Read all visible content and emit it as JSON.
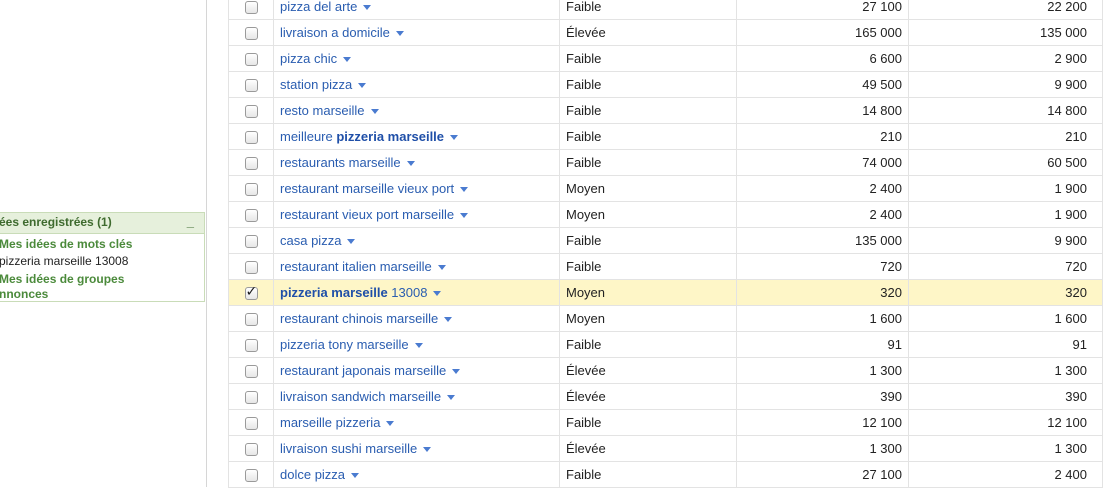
{
  "sidebar": {
    "saved_title": "ées enregistrées (1)",
    "minimize": "_",
    "keyword_ideas_link": "Mes idées de mots clés",
    "saved_keyword": "pizzeria marseille 13008",
    "ad_group_line1": "Mes idées de groupes",
    "ad_group_line2": "nnonces"
  },
  "rows": [
    {
      "pre": "pizza del arte",
      "bold": "",
      "post": "",
      "comp": "Faible",
      "global": "27 100",
      "local": "22 200",
      "checked": false
    },
    {
      "pre": "livraison a domicile",
      "bold": "",
      "post": "",
      "comp": "Élevée",
      "global": "165 000",
      "local": "135 000",
      "checked": false
    },
    {
      "pre": "pizza chic",
      "bold": "",
      "post": "",
      "comp": "Faible",
      "global": "6 600",
      "local": "2 900",
      "checked": false
    },
    {
      "pre": "station pizza",
      "bold": "",
      "post": "",
      "comp": "Faible",
      "global": "49 500",
      "local": "9 900",
      "checked": false
    },
    {
      "pre": "resto marseille",
      "bold": "",
      "post": "",
      "comp": "Faible",
      "global": "14 800",
      "local": "14 800",
      "checked": false
    },
    {
      "pre": "meilleure ",
      "bold": "pizzeria marseille",
      "post": "",
      "comp": "Faible",
      "global": "210",
      "local": "210",
      "checked": false
    },
    {
      "pre": "restaurants marseille",
      "bold": "",
      "post": "",
      "comp": "Faible",
      "global": "74 000",
      "local": "60 500",
      "checked": false
    },
    {
      "pre": "restaurant marseille vieux port",
      "bold": "",
      "post": "",
      "comp": "Moyen",
      "global": "2 400",
      "local": "1 900",
      "checked": false
    },
    {
      "pre": "restaurant vieux port marseille",
      "bold": "",
      "post": "",
      "comp": "Moyen",
      "global": "2 400",
      "local": "1 900",
      "checked": false
    },
    {
      "pre": "casa pizza",
      "bold": "",
      "post": "",
      "comp": "Faible",
      "global": "135 000",
      "local": "9 900",
      "checked": false
    },
    {
      "pre": "restaurant italien marseille",
      "bold": "",
      "post": "",
      "comp": "Faible",
      "global": "720",
      "local": "720",
      "checked": false
    },
    {
      "pre": "",
      "bold": "pizzeria marseille",
      "post": " 13008",
      "comp": "Moyen",
      "global": "320",
      "local": "320",
      "checked": true
    },
    {
      "pre": "restaurant chinois marseille",
      "bold": "",
      "post": "",
      "comp": "Moyen",
      "global": "1 600",
      "local": "1 600",
      "checked": false
    },
    {
      "pre": "pizzeria tony marseille",
      "bold": "",
      "post": "",
      "comp": "Faible",
      "global": "91",
      "local": "91",
      "checked": false
    },
    {
      "pre": "restaurant japonais marseille",
      "bold": "",
      "post": "",
      "comp": "Élevée",
      "global": "1 300",
      "local": "1 300",
      "checked": false
    },
    {
      "pre": "livraison sandwich marseille",
      "bold": "",
      "post": "",
      "comp": "Élevée",
      "global": "390",
      "local": "390",
      "checked": false
    },
    {
      "pre": "marseille pizzeria",
      "bold": "",
      "post": "",
      "comp": "Faible",
      "global": "12 100",
      "local": "12 100",
      "checked": false
    },
    {
      "pre": "livraison sushi marseille",
      "bold": "",
      "post": "",
      "comp": "Élevée",
      "global": "1 300",
      "local": "1 300",
      "checked": false
    },
    {
      "pre": "dolce pizza",
      "bold": "",
      "post": "",
      "comp": "Faible",
      "global": "27 100",
      "local": "2 400",
      "checked": false
    }
  ]
}
